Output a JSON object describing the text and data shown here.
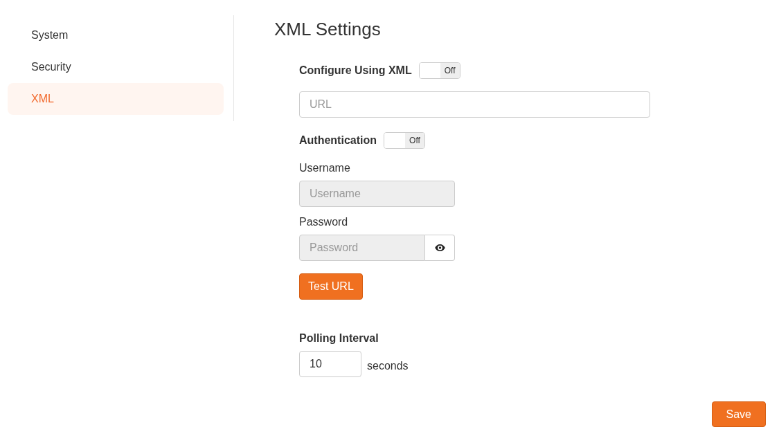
{
  "sidebar": {
    "items": [
      {
        "label": "System",
        "selected": false
      },
      {
        "label": "Security",
        "selected": false
      },
      {
        "label": "XML",
        "selected": true
      }
    ]
  },
  "page_title": "XML Settings",
  "form": {
    "configure_xml": {
      "label": "Configure Using XML",
      "toggle": {
        "on": false,
        "label": "Off"
      }
    },
    "url": {
      "placeholder": "URL"
    },
    "authentication": {
      "label": "Authentication",
      "toggle": {
        "on": false,
        "label": "Off"
      }
    },
    "username": {
      "label": "Username",
      "placeholder": "Username",
      "disabled": true
    },
    "password": {
      "label": "Password",
      "placeholder": "Password",
      "disabled": true
    },
    "test_button": "Test URL",
    "polling_interval": {
      "label": "Polling Interval",
      "value": "10",
      "unit": "seconds"
    }
  },
  "save_button": "Save"
}
